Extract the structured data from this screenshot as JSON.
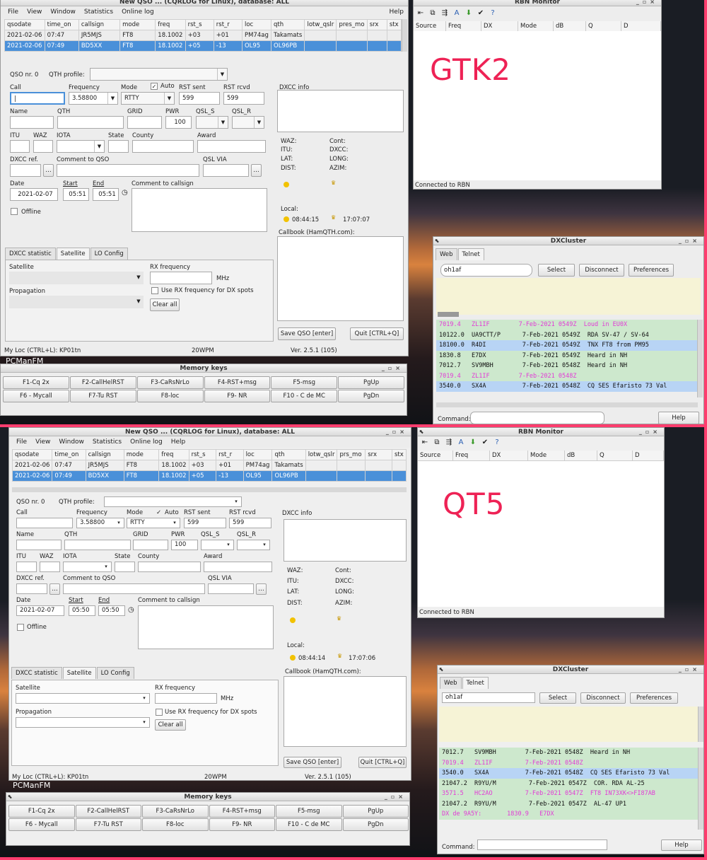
{
  "labels": {
    "top": "GTK2",
    "bottom": "QT5"
  },
  "main": {
    "title": "New QSO ... (CQRLOG for Linux), database: ALL",
    "menu": [
      "File",
      "View",
      "Window",
      "Statistics",
      "Online log"
    ],
    "menu_help": "Help",
    "columns": [
      "qsodate",
      "time_on",
      "callsign",
      "mode",
      "freq",
      "rst_s",
      "rst_r",
      "loc",
      "qth",
      "lotw_qslr",
      "pres_mo",
      "srx",
      "stx"
    ],
    "columns_gtk": [
      "qsodate",
      "time_on",
      "callsign",
      "mode",
      "freq",
      "rst_s",
      "rst_r",
      "loc",
      "qth",
      "lotw_qslr",
      "pres_mo",
      "srx",
      "stx"
    ],
    "columns_qt": [
      "qsodate",
      "time_on",
      "callsign",
      "mode",
      "freq",
      "rst_s",
      "rst_r",
      "loc",
      "qth",
      "lotw_qslr",
      "prs_mo",
      "srx",
      "stx"
    ],
    "rows": [
      [
        "2021-02-06",
        "07:47",
        "JR5MJS",
        "FT8",
        "18.1002",
        "+03",
        "+01",
        "PM74ag",
        "Takamats",
        "",
        "",
        "",
        ""
      ],
      [
        "2021-02-06",
        "07:49",
        "BD5XX",
        "FT8",
        "18.1002",
        "+05",
        "-13",
        "OL95",
        "OL96PB",
        "",
        "",
        "",
        ""
      ]
    ],
    "qso_nr_label": "QSO nr. 0",
    "qth_profile_label": "QTH profile:",
    "fields": {
      "call": "Call",
      "frequency": "Frequency",
      "mode": "Mode",
      "auto": "Auto",
      "rst_sent": "RST sent",
      "rst_rcvd": "RST rcvd",
      "name": "Name",
      "qth": "QTH",
      "grid": "GRID",
      "pwr": "PWR",
      "qsl_s": "QSL_S",
      "qsl_r": "QSL_R",
      "itu": "ITU",
      "waz": "WAZ",
      "iota": "IOTA",
      "state": "State",
      "county": "County",
      "award": "Award",
      "dxcc_ref": "DXCC ref.",
      "comment_qso": "Comment to QSO",
      "qsl_via": "QSL VIA",
      "date": "Date",
      "start": "Start",
      "end": "End",
      "comment_call": "Comment to callsign",
      "offline": "Offline"
    },
    "freq_value": "3.58800",
    "mode_value": "RTTY",
    "rst_sent_value": "599",
    "rst_rcvd_value": "599",
    "pwr_value": "100",
    "date_value": "2021-02-07",
    "gtk_start": "05:51",
    "gtk_end": "05:51",
    "qt_start": "05:50",
    "qt_end": "05:50",
    "dxcc_info": "DXCC info",
    "info_labels": {
      "waz": "WAZ:",
      "itu": "ITU:",
      "lat": "LAT:",
      "dist": "DIST:",
      "cont": "Cont:",
      "dxcc": "DXCC:",
      "long": "LONG:",
      "azim": "AZIM:",
      "local": "Local:"
    },
    "gtk_local_time": "08:44:15",
    "gtk_sunset": "17:07:07",
    "qt_local_time": "08:44:14",
    "qt_sunset": "17:07:06",
    "callbook": "Callbook (HamQTH.com):",
    "tabs": [
      "DXCC statistic",
      "Satellite",
      "LO Config"
    ],
    "satellite": "Satellite",
    "rx_freq": "RX frequency",
    "mhz": "MHz",
    "propagation": "Propagation",
    "use_rx": "Use RX frequency for DX spots",
    "clear_all": "Clear all",
    "save_btn": "Save QSO [enter]",
    "quit_btn": "Quit [CTRL+Q]",
    "status_loc": "My Loc (CTRL+L): KP01tn",
    "status_wpm": "20WPM",
    "status_ver": "Ver. 2.5.1 (105)"
  },
  "rbn": {
    "title": "RBN Monitor",
    "columns": [
      "Source",
      "Freq",
      "DX",
      "Mode",
      "dB",
      "Q",
      "D"
    ],
    "status": "Connected to RBN"
  },
  "dxc": {
    "title": "DXCluster",
    "tabs": [
      "Web",
      "Telnet"
    ],
    "host": "oh1af",
    "select": "Select",
    "disconnect": "Disconnect",
    "preferences": "Preferences",
    "command": "Command:",
    "help": "Help",
    "gtk_spots": [
      {
        "t": "7019.4   ZL1IF        7-Feb-2021 0549Z  Loud in EU0X",
        "c": "mag"
      },
      {
        "t": "10122.0  UA9CTT/P      7-Feb-2021 0549Z  RDA SV-47 / SV-64",
        "c": ""
      },
      {
        "t": "18100.0  R4DI          7-Feb-2021 0549Z  TNX FT8 from PM95",
        "c": "blue"
      },
      {
        "t": "1830.8   E7DX          7-Feb-2021 0549Z  Heard in NH",
        "c": ""
      },
      {
        "t": "7012.7   SV9MBH        7-Feb-2021 0548Z  Heard in NH",
        "c": ""
      },
      {
        "t": "7019.4   ZL1IF        7-Feb-2021 0548Z",
        "c": "mag"
      },
      {
        "t": "3540.0   SX4A          7-Feb-2021 0548Z  CQ SES Efaristo 73 Val",
        "c": "blue"
      }
    ],
    "qt_spots": [
      {
        "t": "7012.7   SV9MBH        7-Feb-2021 0548Z  Heard in NH",
        "c": ""
      },
      {
        "t": "7019.4   ZL1IF         7-Feb-2021 0548Z",
        "c": "mag"
      },
      {
        "t": "3540.0   SX4A          7-Feb-2021 0548Z  CQ SES Efaristo 73 Val",
        "c": "blue"
      },
      {
        "t": "21047.2  R9YU/M         7-Feb-2021 0547Z  COR. RDA AL-25",
        "c": ""
      },
      {
        "t": "3571.5   HC2AO         7-Feb-2021 0547Z  FT8 IN73XK<>FI87AB",
        "c": "mag"
      },
      {
        "t": "21047.2  R9YU/M         7-Feb-2021 0547Z  AL-47 UP1",
        "c": ""
      },
      {
        "t": "DX de 9A5Y:       1830.9   E7DX",
        "c": "mag"
      }
    ]
  },
  "mem": {
    "title": "Memory keys",
    "keys": [
      "F1-Cq 2x",
      "F2-CallHelRST",
      "F3-CaRsNrLo",
      "F4-RST+msg",
      "F5-msg",
      "PgUp",
      "F6 - Mycall",
      "F7-Tu RST",
      "F8-loc",
      "F9- NR",
      "F10 - C de MC",
      "PgDn"
    ]
  },
  "desktop": {
    "pcmanfm": "PCManFM"
  },
  "colors": {
    "accent": "#4a90d9",
    "label": "#ee2255",
    "border": "#ff3d6e"
  }
}
